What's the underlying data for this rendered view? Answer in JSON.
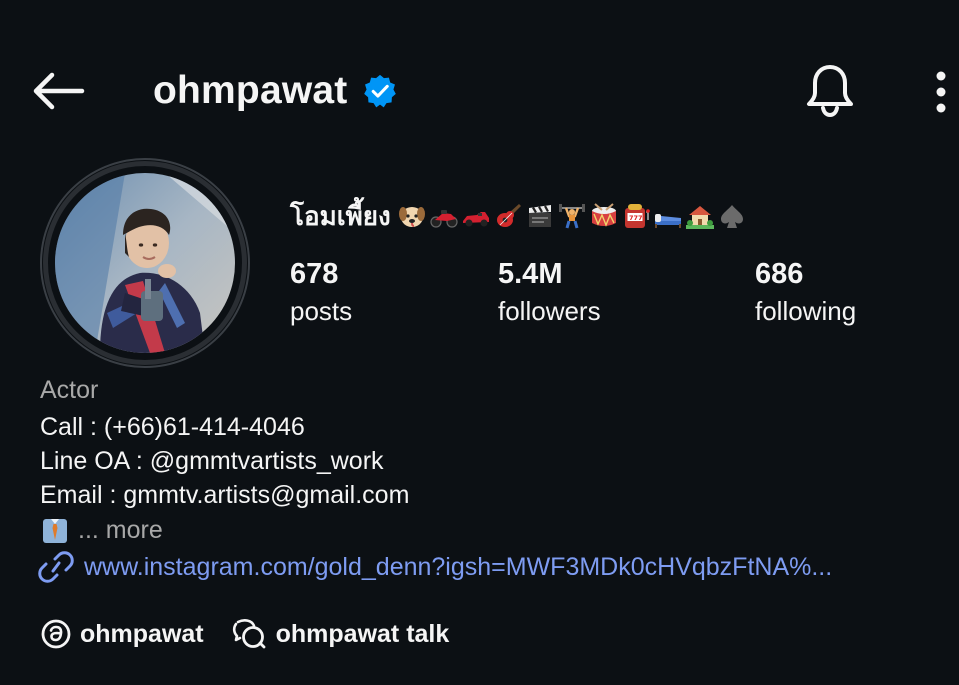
{
  "header": {
    "username": "ohmpawat",
    "verified": true,
    "accent": "#0095f6"
  },
  "profile": {
    "display_name": "โอมเพี้ยง",
    "display_emojis": [
      "dog-face",
      "motorcycle",
      "race-car",
      "guitar",
      "clapper-board",
      "weight-lifter",
      "drum",
      "slot-machine",
      "bed",
      "house-garden",
      "spade-suit"
    ],
    "stats": {
      "posts": {
        "value": "678",
        "label": "posts"
      },
      "followers": {
        "value": "5.4M",
        "label": "followers"
      },
      "following": {
        "value": "686",
        "label": "following"
      }
    },
    "category": "Actor",
    "bio": {
      "line1": "Call : (+66)61-414-4046",
      "line2": "Line OA : @gmmtvartists_work",
      "line3": "Email : gmmtv.artists@gmail.com",
      "more": "... more"
    },
    "link": "www.instagram.com/gold_denn?igsh=MWF3MDk0cHVqbzFtNA%...",
    "threads_label": "ohmpawat",
    "talk_label": "ohmpawat talk"
  },
  "colors": {
    "background": "#0c1014",
    "text": "#f5f5f5",
    "secondary_text": "#a8a8a8",
    "link": "#7e9cf2"
  }
}
